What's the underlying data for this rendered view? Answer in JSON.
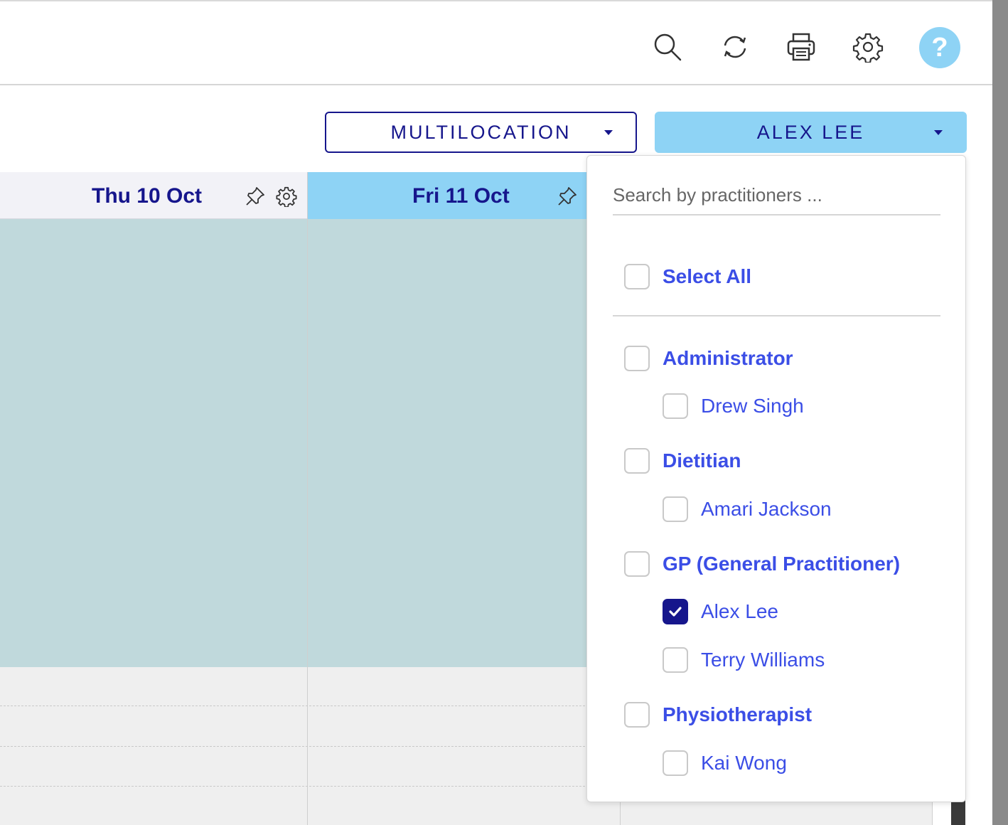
{
  "toolbar": {
    "icons": [
      "search-icon",
      "refresh-icon",
      "print-icon",
      "gear-icon"
    ],
    "help_label": "?"
  },
  "filters": {
    "location_label": "MULTILOCATION",
    "practitioner_label": "ALEX LEE"
  },
  "calendar": {
    "days": [
      {
        "label": "Thu 10 Oct"
      },
      {
        "label": "Fri 11 Oct"
      }
    ]
  },
  "colors": {
    "accent": "#8ed3f5",
    "navy": "#16168c",
    "link_blue": "#3b4ee6",
    "calendar_block": "#c0d9dc"
  },
  "practitioner_dropdown": {
    "search_placeholder": "Search by practitioners ...",
    "select_all": "Select All",
    "groups": [
      {
        "label": "Administrator",
        "members": [
          {
            "name": "Drew Singh",
            "checked": false
          }
        ]
      },
      {
        "label": "Dietitian",
        "members": [
          {
            "name": "Amari Jackson",
            "checked": false
          }
        ]
      },
      {
        "label": "GP (General Practitioner)",
        "members": [
          {
            "name": "Alex Lee",
            "checked": true
          },
          {
            "name": "Terry Williams",
            "checked": false
          }
        ]
      },
      {
        "label": "Physiotherapist",
        "members": [
          {
            "name": "Kai Wong",
            "checked": false
          }
        ]
      }
    ]
  }
}
